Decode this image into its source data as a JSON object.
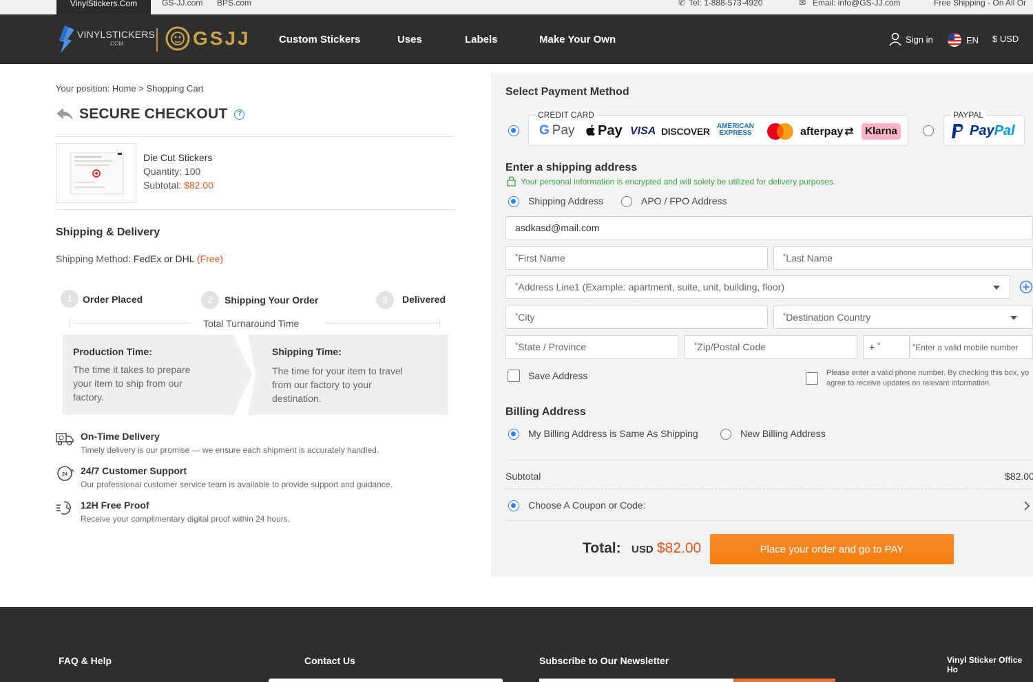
{
  "topbar": {
    "sites": [
      "VinylStickers.Com",
      "GS-JJ.com",
      "BPS.com"
    ],
    "tel": "Tel: 1-888-573-4920",
    "email": "Email: info@GS-JJ.com",
    "promo": "Free Shipping - On All Or"
  },
  "header": {
    "logo_vs": "VINYLSTICKERS",
    "logo_vs_sub": ".COM",
    "logo_gsjj": "GSJJ",
    "nav": [
      "Custom Stickers",
      "Uses",
      "Labels",
      "Make Your Own"
    ],
    "sign_in": "Sign in",
    "language": "EN",
    "currency": "$ USD"
  },
  "breadcrumb": "Your position: Home > Shopping Cart",
  "checkout_title": "SECURE CHECKOUT",
  "product": {
    "name": "Die Cut Stickers",
    "quantity_label": "Quantity:",
    "quantity": "100",
    "subtotal_label": "Subtotal:",
    "subtotal": "$82.00"
  },
  "shipping": {
    "title": "Shipping & Delivery",
    "method_label": "Shipping Method:",
    "method": "FedEx or DHL",
    "free": "(Free)",
    "steps": [
      {
        "num": "1",
        "label": "Order Placed"
      },
      {
        "num": "2",
        "label": "Shipping Your Order"
      },
      {
        "num": "3",
        "label": "Delivered"
      }
    ],
    "turnaround": "Total Turnaround Time",
    "production_title": "Production Time:",
    "production_desc_lines": [
      "The time it takes to prepare",
      "your item to ship from our",
      "factory."
    ],
    "shipping_title": "Shipping Time:",
    "shipping_desc_lines": [
      "The time for your item to travel",
      "from our factory to your",
      "destination."
    ]
  },
  "features": [
    {
      "icon": "truck-clock-icon",
      "title": "On-Time Delivery",
      "desc": "Timely delivery is our promise — we ensure each shipment is accurately handled."
    },
    {
      "icon": "24h-support-icon",
      "title": "24/7 Customer Support",
      "desc": "Our professional customer service team is available to provide support and guidance."
    },
    {
      "icon": "fast-clock-icon",
      "title": "12H Free Proof",
      "desc": "Receive your complimentary digital proof within 24 hours."
    }
  ],
  "payment": {
    "title": "Select Payment Method",
    "credit_card_legend": "CREDIT CARD",
    "paypal_legend": "PAYPAL",
    "brands": {
      "gpay": "G Pay",
      "applepay": "Pay",
      "visa": "VISA",
      "discover": "DISCOVER",
      "amex_1": "AMERICAN",
      "amex_2": "EXPRESS",
      "afterpay": "afterpay",
      "klarna": "Klarna",
      "paypal": "PayPal"
    },
    "selected": "credit_card"
  },
  "address": {
    "title": "Enter a shipping address",
    "secure_note": "Your personal information is encrypted and will solely be utilized for delivery purposes.",
    "type_options": [
      "Shipping Address",
      "APO / FPO Address"
    ],
    "email_value": "asdkasd@mail.com",
    "first_name_placeholder": "First Name",
    "last_name_placeholder": "Last Name",
    "address1_placeholder": "Address Line1 (Example: apartment, suite, unit, building, floor)",
    "city_placeholder": "City",
    "country_placeholder": "Destination Country",
    "state_placeholder": "State / Province",
    "zip_placeholder": "Zip/Postal Code",
    "phone_prefix": "+",
    "phone_placeholder": "Enter a valid mobile number",
    "required_mark": "*",
    "save_address_label": "Save Address",
    "sms_consent_line1": "Please enter a valid phone number. By checking this box, yo",
    "sms_consent_line2": "agree to receive updates on relevant information."
  },
  "billing": {
    "title": "Billing Address",
    "options": [
      "My Billing Address is Same As Shipping",
      "New Billing Address"
    ]
  },
  "summary": {
    "subtotal_label": "Subtotal",
    "subtotal_value": "$82.00",
    "coupon_label": "Choose A Coupon or Code:",
    "total_label": "Total:",
    "total_currency": "USD",
    "total_value": "$82.00",
    "pay_button": "Place your order and go to PAY"
  },
  "footer": {
    "links": [
      "FAQ & Help",
      "Contact Us",
      "Subscribe to Our Newsletter",
      "Vinyl Sticker Office Ho"
    ]
  }
}
